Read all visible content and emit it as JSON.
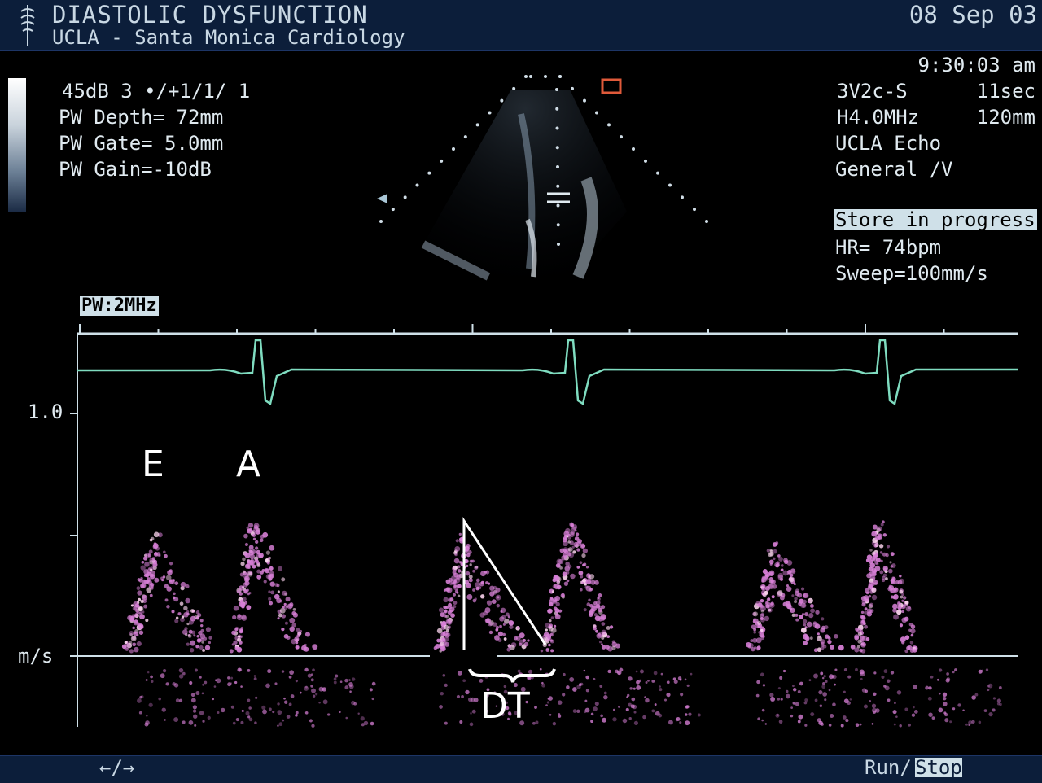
{
  "header": {
    "title": "DIASTOLIC   DYSFUNCTION",
    "subtitle": "UCLA - Santa Monica Cardiology",
    "date": "08 Sep 03",
    "time": "9:30:03 am"
  },
  "params_left": {
    "line1": "45dB  3 •/+1/1/ 1",
    "line2": "PW Depth=  72mm",
    "line3": "PW Gate=  5.0mm",
    "line4": "PW Gain=-10dB"
  },
  "params_right": {
    "probe": "3V2c-S",
    "duration": "11sec",
    "freq": "H4.0MHz",
    "depth": "120mm",
    "site": "UCLA Echo",
    "preset": "General /V",
    "store": "Store in progress",
    "hr": "HR=  74bpm",
    "sweep": "Sweep=100mm/s"
  },
  "doppler": {
    "mode_label": "PW:2MHz",
    "scale_top": "1.0",
    "unit": "m/s",
    "label_e": "E",
    "label_a": "A",
    "label_dt": "DT"
  },
  "footer": {
    "arrows": "←/→",
    "run": "Run/",
    "stop": "Stop"
  },
  "colors": {
    "ecg": "#7fdcc0",
    "doppler": "#d77fd6",
    "header_bg": "#0c1e3a"
  }
}
